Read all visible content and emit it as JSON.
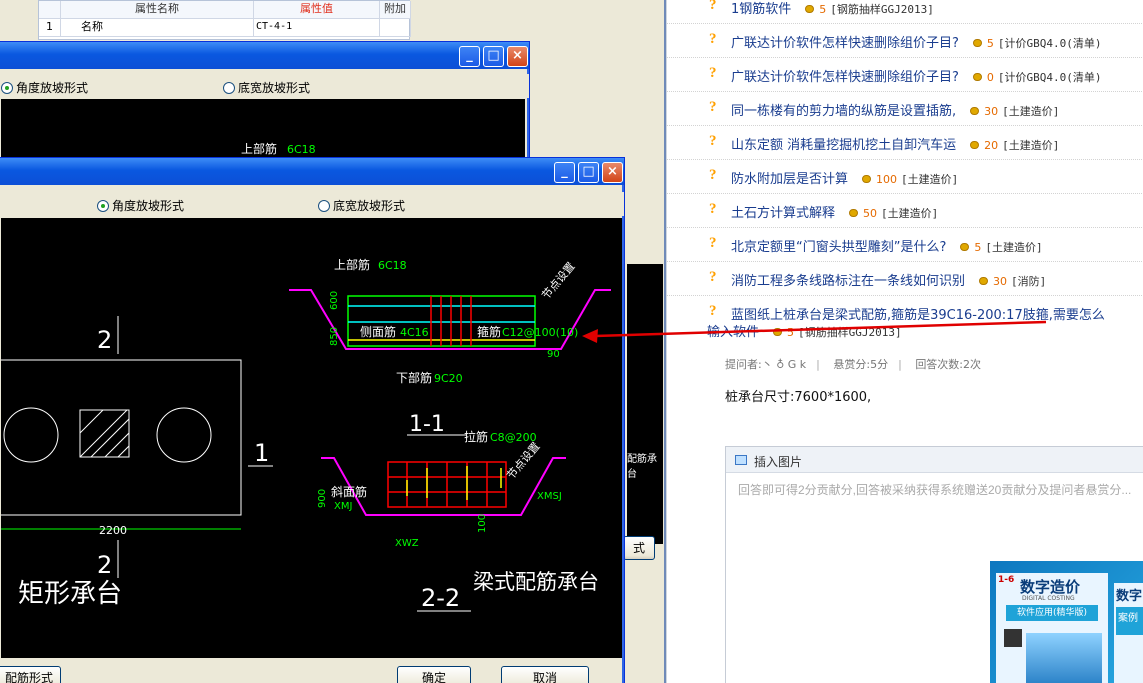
{
  "property_table": {
    "headers": [
      "属性名称",
      "属性值",
      "附加"
    ],
    "rows": [
      {
        "num": "1",
        "name": "名称",
        "value": "CT-4-1"
      }
    ]
  },
  "back_dialog": {
    "radio_angle": "角度放坡形式",
    "radio_bottom": "底宽放坡形式",
    "top_rebar_label": "上部筋",
    "top_rebar_value": "6C18",
    "partial_button": "式"
  },
  "front_dialog": {
    "radio_angle": "角度放坡形式",
    "radio_bottom": "底宽放坡形式",
    "ok_button": "确定",
    "cancel_button": "取消",
    "left_button": "配筋形式",
    "side_label": "配筋承台",
    "cad": {
      "top_rebar_label": "上部筋",
      "top_rebar_value": "6C18",
      "side_rebar_label": "侧面筋",
      "side_rebar_value": "4C16",
      "stirrup_label": "箍筋",
      "stirrup_value": "C12@100(10)",
      "bottom_rebar_label": "下部筋",
      "bottom_rebar_value": "9C20",
      "tie_label": "拉筋",
      "tie_value": "C8@200",
      "slope_rebar_label": "斜面筋",
      "xmj": "XMJ",
      "xmsj": "XMSJ",
      "xwz": "XWZ",
      "node_setting": "节点设置",
      "dim_600": "600",
      "dim_850": "850",
      "dim_90": "90",
      "dim_900": "900",
      "dim_100": "100",
      "dim_2200": "2200",
      "section_2": "2",
      "section_1": "1",
      "section_11": "1-1",
      "section_22": "2-2",
      "rect_cap": "矩形承台",
      "beam_cap": "梁式配筋承台"
    }
  },
  "qa_list": [
    {
      "title": "1钢筋软件",
      "score": "5",
      "category": "[钢筋抽样GGJ2013]"
    },
    {
      "title": "广联达计价软件怎样快速删除组价子目?",
      "score": "5",
      "category": "[计价GBQ4.0(清单)"
    },
    {
      "title": "广联达计价软件怎样快速删除组价子目?",
      "score": "0",
      "category": "[计价GBQ4.0(清单)"
    },
    {
      "title": "同一栋楼有的剪力墙的纵筋是设置插筋,",
      "score": "30",
      "category": "[土建造价]"
    },
    {
      "title": "山东定额 消耗量挖掘机挖土自卸汽车运",
      "score": "20",
      "category": "[土建造价]"
    },
    {
      "title": "防水附加层是否计算",
      "score": "100",
      "category": "[土建造价]"
    },
    {
      "title": "土石方计算式解释",
      "score": "50",
      "category": "[土建造价]"
    },
    {
      "title": "北京定额里“门窗头拱型雕刻”是什么?",
      "score": "5",
      "category": "[土建造价]"
    },
    {
      "title": "消防工程多条线路标注在一条线如何识别",
      "score": "30",
      "category": "[消防]"
    },
    {
      "title": "蓝图纸上桩承台是梁式配筋,箍筋是39C16-200:17肢箍,需要怎么",
      "score": "",
      "category": ""
    }
  ],
  "qa_last_line2": {
    "title": "输入软件",
    "score": "5",
    "category": "[钢筋抽样GGJ2013]"
  },
  "question_detail": {
    "asker": "提问者:丶 ♁ G k",
    "reward": "悬赏分:5分",
    "answers": "回答次数:2次",
    "body": "桩承台尺寸:7600*1600,",
    "insert_image": "插入图片",
    "answer_placeholder": "回答即可得2分贡献分,回答被采纳获得系统赠送20贡献分及提问者悬赏分..."
  },
  "ad": {
    "title": "数字造价",
    "subtitle": "软件应用(精华版)",
    "small": "DIGITAL COSTING",
    "issue": "1-6",
    "side_title": "数字",
    "side_sub": "案例"
  },
  "colors": {
    "link": "#1a3d8f",
    "score": "#e56a00",
    "cad_green": "#00ff00",
    "cad_red": "#ff0000",
    "arrow": "#e00000"
  }
}
